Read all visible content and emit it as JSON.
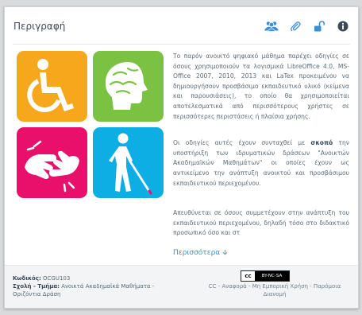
{
  "panel": {
    "title": "Περιγραφή"
  },
  "header_icons": [
    {
      "icon": "users-icon",
      "color": "#3a8fd5"
    },
    {
      "icon": "paperclip-icon",
      "color": "#3a8fd5"
    },
    {
      "icon": "unlock-icon",
      "color": "#3a8fd5"
    },
    {
      "icon": "info-icon",
      "color": "#3c4a57"
    }
  ],
  "tiles": [
    {
      "icon": "wheelchair-icon",
      "color": "#f7a71b"
    },
    {
      "icon": "brain-icon",
      "color": "#7cc242"
    },
    {
      "icon": "sign-language-icon",
      "color": "#e8106a"
    },
    {
      "icon": "blind-person-icon",
      "color": "#0daee3"
    }
  ],
  "description": {
    "p1": "Το παρόν ανοικτό ψηφιακό μάθημα παρέχει οδηγίες σε όσους χρησιμοποιούν τα λογισμικά LibreOffice 4.0, MS-Office 2007, 2010, 2013 και LaTex προκειμένου να δημιουργήσουν προσβάσιμο εκπαιδευτικό υλικό (κείμενα και παρουσιάσεις), το οποίο θα χρησιμοποιείται αποτελεσματικά από περισσότερους χρήστες σε περισσότερες περιστάσεις ή πλαίσια χρήσης.",
    "p2_before": "Οι οδηγίες αυτές έχουν συνταχθεί με ",
    "p2_bold": "σκοπό",
    "p2_after": " την υποστήριξη των ιδρυματικών δράσεων \"Ανοικτών Ακαδημαϊκών Μαθημάτων\" οι οποίες έχουν ως αντικείμενο την ανάπτυξη ανοικτού και προσβάσιμου εκπαιδευτικού περιεχομένου.",
    "p3": "Απευθύνεται σε όσους συμμετέχουν στην ανάπτυξη του εκπαιδευτικού περιεχομένου, δηλαδή τόσο στο διδακτικό προσωπικό όσο και στ",
    "more_label": "Περισσότερα",
    "more_arrow": "🡫"
  },
  "footer": {
    "code_label": "Κωδικός:",
    "code_value": "OCGU103",
    "dept_label": "Σχολή - Τμήμα:",
    "dept_value": "Ανοικτά Ακαδημαϊκά Μαθήματα - Οριζόντια Δράση",
    "cc_badge_left": "cc",
    "cc_badge_right": "BY-NC-SA",
    "license_text": "CC - Αναφορά - Μη Εμπορική Χρήση - Παρόμοια Διανομή"
  }
}
